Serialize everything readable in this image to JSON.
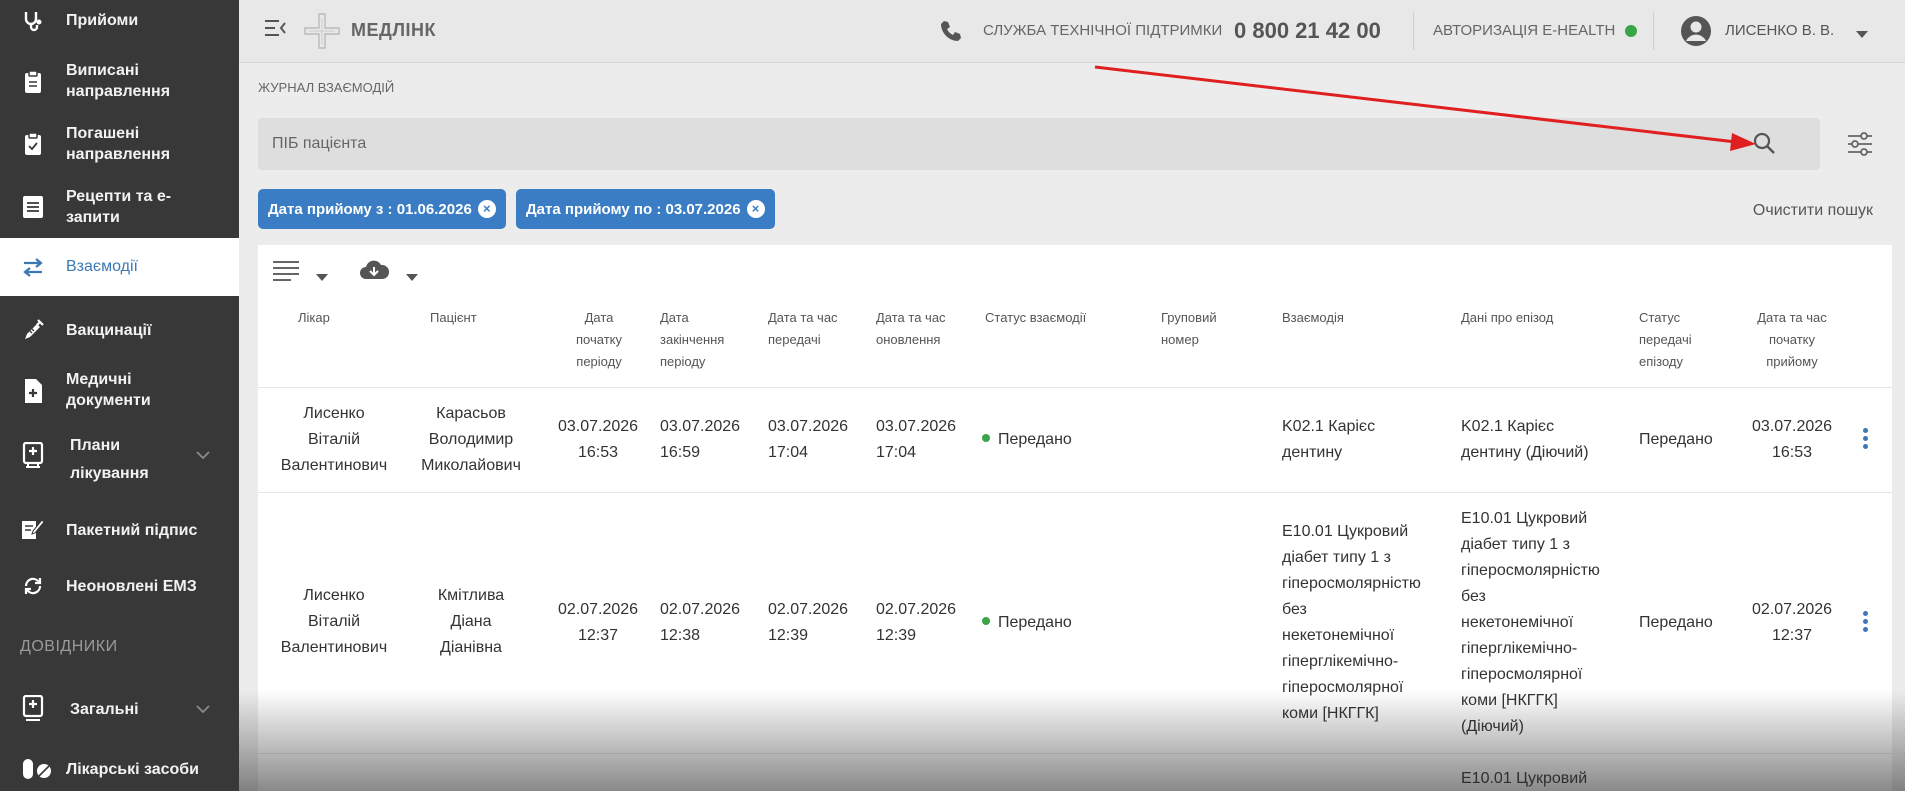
{
  "sidebar": {
    "items": [
      {
        "label": "Прийоми"
      },
      {
        "label": "Виписані\nнаправлення"
      },
      {
        "label": "Погашені\nнаправлення"
      },
      {
        "label": "Рецепти та е-\nзапити"
      },
      {
        "label": "Взаємодії"
      },
      {
        "label": "Вакцинації"
      },
      {
        "label": "Медичні\nдокументи"
      },
      {
        "label": "Плани\nлікування"
      },
      {
        "label": "Пакетний підпис"
      },
      {
        "label": "Неоновлені ЕМЗ"
      },
      {
        "label": "Загальні"
      },
      {
        "label": "Лікарські засоби"
      }
    ],
    "section_label": "ДОВІДНИКИ"
  },
  "topbar": {
    "logo_text": "МЕДЛІНК",
    "support_label": "СЛУЖБА ТЕХНІЧНОЇ ПІДТРИМКИ",
    "support_phone": "0 800 21 42 00",
    "ehealth_label": "АВТОРИЗАЦІЯ E-HEALTH",
    "user_name": "ЛИСЕНКО В. В."
  },
  "page": {
    "title": "ЖУРНАЛ ВЗАЄМОДІЙ",
    "search_placeholder": "ПІБ пацієнта",
    "filters": [
      {
        "label": "Дата прийому з : 01.06.2026"
      },
      {
        "label": "Дата прийому по : 03.07.2026"
      }
    ],
    "clear_label": "Очистити пошук"
  },
  "table": {
    "headers": [
      "Лікар",
      "Пацієнт",
      "Дата\nпочатку\nперіоду",
      "Дата\nзакінчення\nперіоду",
      "Дата та час\nпередачі",
      "Дата та час\nоновлення",
      "Статус взаємодії",
      "Груповий\nномер",
      "Взаємодія",
      "Дані про епізод",
      "Статус\nпередачі\nепізоду",
      "Дата та час\nпочатку\nприйому"
    ],
    "rows": [
      {
        "doctor": "Лисенко\nВіталій\nВалентинович",
        "patient": "Карасьов\nВолодимир\nМиколайович",
        "period_start": "03.07.2026\n16:53",
        "period_end": "03.07.2026\n16:59",
        "sent_at": "03.07.2026\n17:04",
        "updated_at": "03.07.2026\n17:04",
        "status": "Передано",
        "group_number": "",
        "interaction": "K02.1 Карієс\nдентину",
        "episode": "K02.1 Карієс\nдентину (Діючий)",
        "episode_status": "Передано",
        "visit_start": "03.07.2026\n16:53"
      },
      {
        "doctor": "Лисенко\nВіталій\nВалентинович",
        "patient": "Кмітлива\nДіана\nДіанівна",
        "period_start": "02.07.2026\n12:37",
        "period_end": "02.07.2026\n12:38",
        "sent_at": "02.07.2026\n12:39",
        "updated_at": "02.07.2026\n12:39",
        "status": "Передано",
        "group_number": "",
        "interaction": "E10.01 Цукровий\nдіабет типу 1 з\nгіперосмолярністю\nбез\nнекетонемічної\nгіперглікемічно-\nгіперосмолярної\nкоми [НКГГК]",
        "episode": "E10.01 Цукровий\nдіабет типу 1 з\nгіперосмолярністю\nбез\nнекетонемічної\nгіперглікемічно-\nгіперосмолярної\nкоми [НКГГК]\n(Діючий)",
        "episode_status": "Передано",
        "visit_start": "02.07.2026\n12:37"
      }
    ],
    "partial_row_text": "E10.01 Цукровий"
  },
  "colors": {
    "sidebar_bg": "#383838",
    "accent": "#3b7dc4",
    "status_ok": "#3aa548",
    "annotation_arrow": "#e02020"
  }
}
